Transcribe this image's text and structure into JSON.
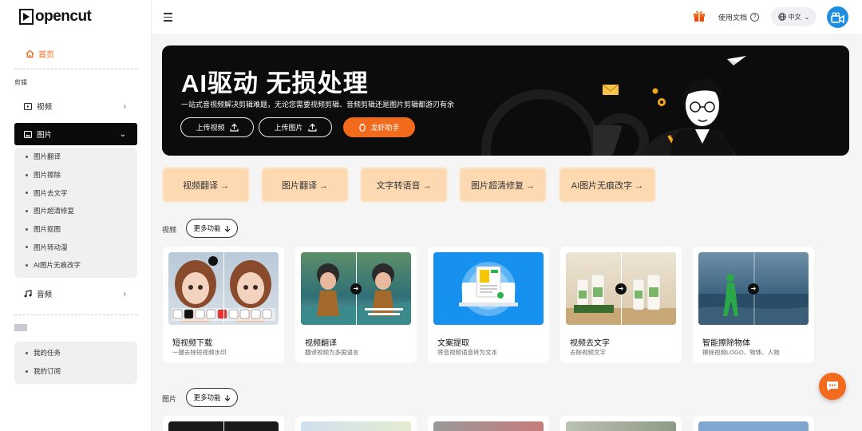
{
  "app": {
    "logo_text": "opencut"
  },
  "header": {
    "docs_label": "使用文档",
    "language": "中文",
    "colors": {
      "accent": "#f26a1b",
      "avatar": "#1f8ee0"
    }
  },
  "sidebar": {
    "home_label": "首页",
    "section_edit": "剪辑",
    "video_label": "视频",
    "image_label": "图片",
    "image_sub": [
      "图片翻译",
      "图片擦除",
      "图片去文字",
      "图片超清修复",
      "图片抠图",
      "图片转动漫",
      "AI图片无痕改字"
    ],
    "audio_label": "音频",
    "account_items": [
      "我的任务",
      "我的订阅"
    ]
  },
  "banner": {
    "title": "AI驱动 无损处理",
    "subtitle": "一站式音视频解决剪辑难题，无论您需要视频剪辑、音频剪辑还是图片剪辑都游刃有余",
    "upload_video": "上传视频",
    "upload_image": "上传图片",
    "assistant": "龙虾助手"
  },
  "quick_tools": [
    "视频翻译 →",
    "图片翻译 →",
    "文字转语音 →",
    "图片超清修复 →",
    "AI图片无痕改字 →"
  ],
  "video_section": {
    "title": "视频",
    "more_label": "更多功能",
    "cards": [
      {
        "title": "短视频下载",
        "desc": "一键去除短视频水印"
      },
      {
        "title": "视频翻译",
        "desc": "翻译视频为多国语言"
      },
      {
        "title": "文案提取",
        "desc": "将音视频语音转为文本"
      },
      {
        "title": "视频去文字",
        "desc": "去除视频文字"
      },
      {
        "title": "智能擦除物体",
        "desc": "擦除视频LOGO、物体、人物"
      }
    ]
  },
  "image_section": {
    "title": "图片",
    "more_label": "更多功能"
  }
}
